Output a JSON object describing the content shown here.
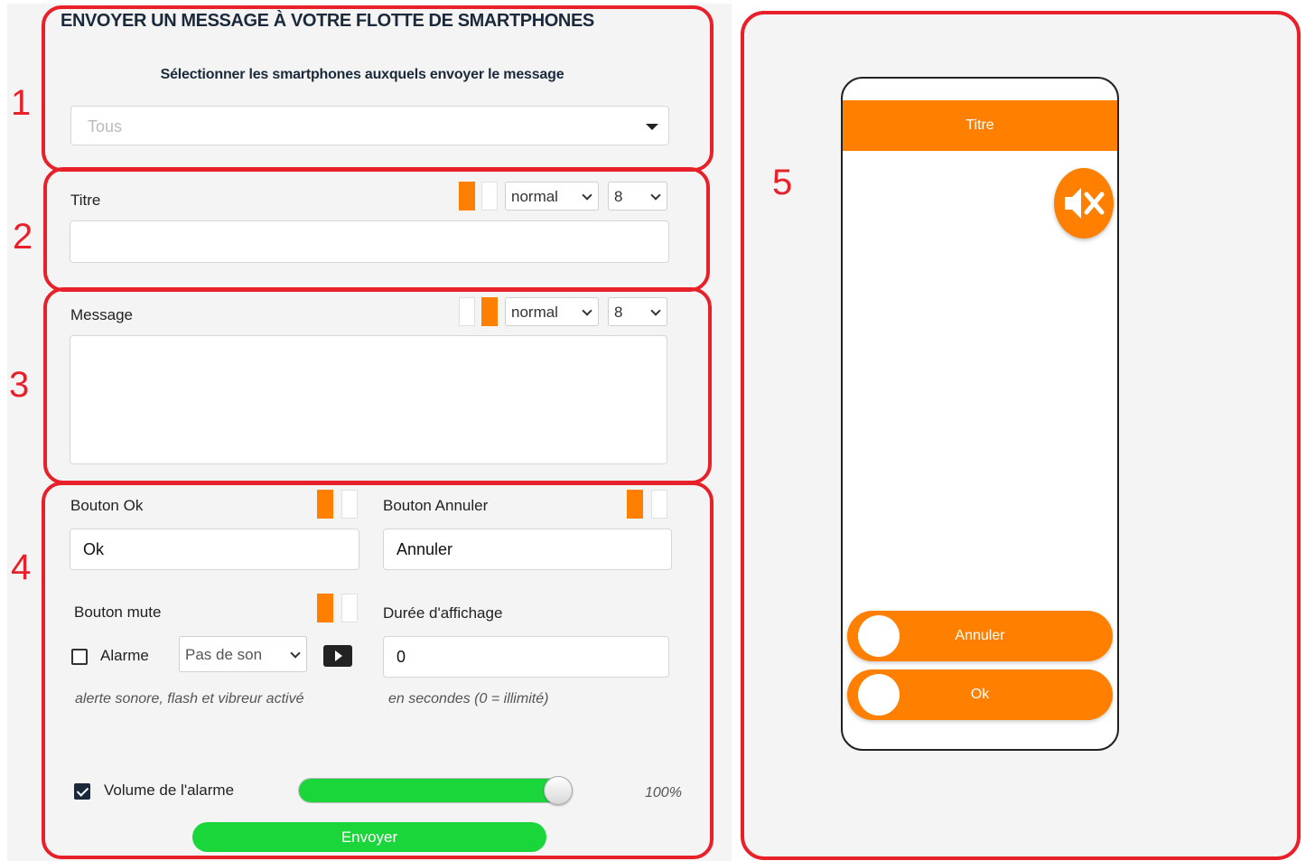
{
  "form": {
    "title": "ENVOYER UN MESSAGE À VOTRE FLOTTE DE SMARTPHONES",
    "subtitle": "Sélectionner les smartphones auxquels envoyer le message",
    "device_select_value": "Tous"
  },
  "markers": [
    "1",
    "2",
    "3",
    "4",
    "5"
  ],
  "title_section": {
    "label": "Titre",
    "style_value": "normal",
    "size_value": "8",
    "input_value": ""
  },
  "message_section": {
    "label": "Message",
    "style_value": "normal",
    "size_value": "8",
    "input_value": ""
  },
  "buttons_section": {
    "ok_label": "Bouton Ok",
    "ok_value": "Ok",
    "cancel_label": "Bouton Annuler",
    "cancel_value": "Annuler",
    "mute_label": "Bouton mute",
    "alarm_label": "Alarme",
    "alarm_checked": false,
    "sound_select_value": "Pas de son",
    "alarm_hint": "alerte sonore, flash et vibreur activé",
    "duration_label": "Durée d'affichage",
    "duration_value": "0",
    "duration_hint": "en secondes (0 = illimité)",
    "volume_label": "Volume de l'alarme",
    "volume_checked": true,
    "volume_percent": 100,
    "volume_text": "100%",
    "send_label": "Envoyer"
  },
  "preview": {
    "header_title": "Titre",
    "cancel_button": "Annuler",
    "ok_button": "Ok"
  },
  "colors": {
    "accent": "#ff7f00",
    "success": "#1bd63b",
    "annotation": "#e8202a"
  }
}
